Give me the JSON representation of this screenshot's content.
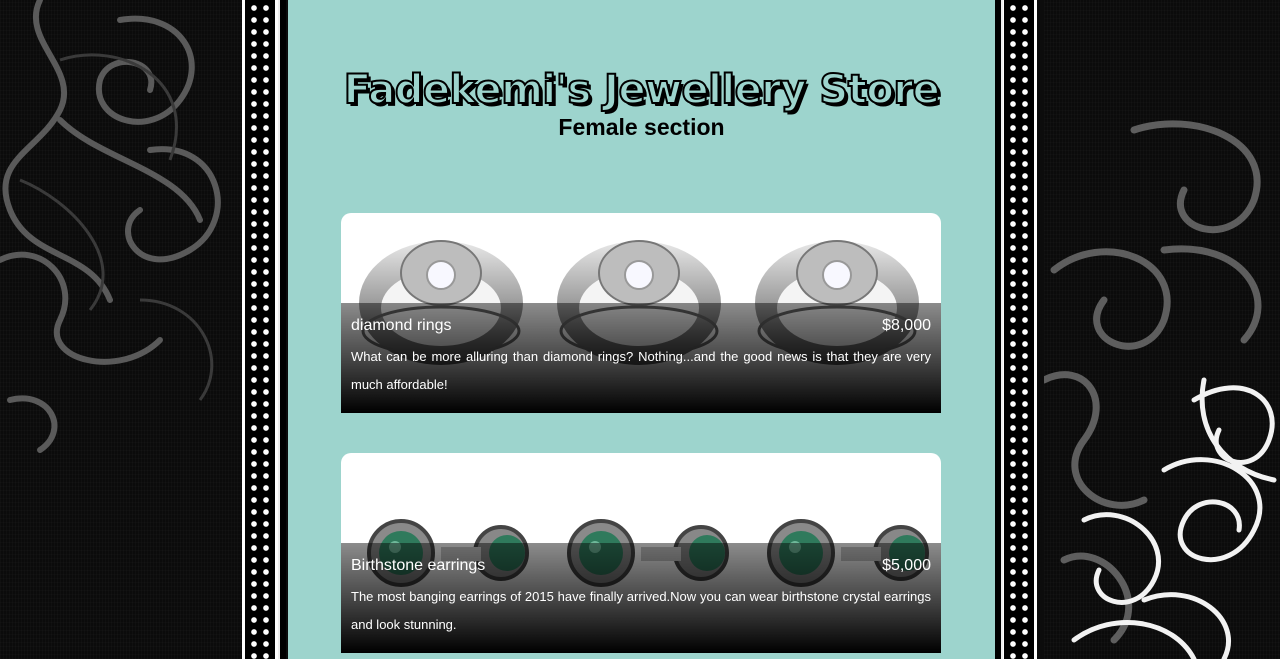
{
  "store": {
    "title": "Fadekemi's Jewellery Store",
    "section": "Female section"
  },
  "products": [
    {
      "name": "diamond rings",
      "price": "$8,000",
      "description": "What can be more alluring than diamond rings? Nothing...and the good news is that they are very much affordable!"
    },
    {
      "name": "Birthstone earrings",
      "price": "$5,000",
      "description": "The most banging earrings of 2015 have finally arrived.Now you can wear birthstone crystal earrings and look stunning."
    }
  ],
  "colors": {
    "content_background": "#9dd4cd",
    "page_background": "#0b0b0b",
    "caption_text": "#ffffff"
  }
}
